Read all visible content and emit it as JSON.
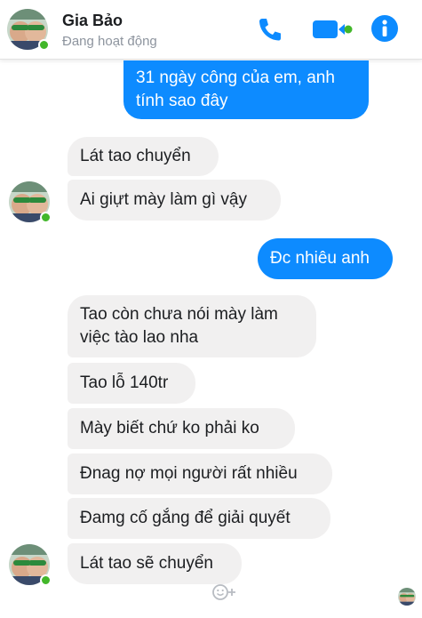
{
  "header": {
    "contact_name": "Gia Bảo",
    "status": "Đang hoạt động"
  },
  "messages": [
    {
      "direction": "out",
      "lines": [
        "31 ngày công của em, anh",
        "tính sao đây"
      ]
    },
    {
      "direction": "in",
      "lines": [
        "Lát tao chuyển"
      ]
    },
    {
      "direction": "in",
      "lines": [
        "Ai giựt mày làm gì vậy"
      ]
    },
    {
      "direction": "out",
      "lines": [
        "Đc nhiêu anh"
      ]
    },
    {
      "direction": "in",
      "lines": [
        "Tao còn chưa nói mày làm",
        "việc tào lao nha"
      ]
    },
    {
      "direction": "in",
      "lines": [
        "Tao lỗ 140tr"
      ]
    },
    {
      "direction": "in",
      "lines": [
        "Mày biết chứ ko phải ko"
      ]
    },
    {
      "direction": "in",
      "lines": [
        "Đnag nợ mọi người rất nhiều"
      ]
    },
    {
      "direction": "in",
      "lines": [
        "Đamg cố gắng để giải quyết"
      ]
    },
    {
      "direction": "in",
      "lines": [
        "Lát tao sẽ chuyển"
      ]
    }
  ],
  "colors": {
    "accent": "#0d8bff",
    "incoming_bubble": "#f1f0f0",
    "online_dot": "#42b72a"
  },
  "icons": {
    "call": "phone-icon",
    "video": "video-camera-icon",
    "info": "info-icon",
    "react": "emoji-plus-icon"
  }
}
